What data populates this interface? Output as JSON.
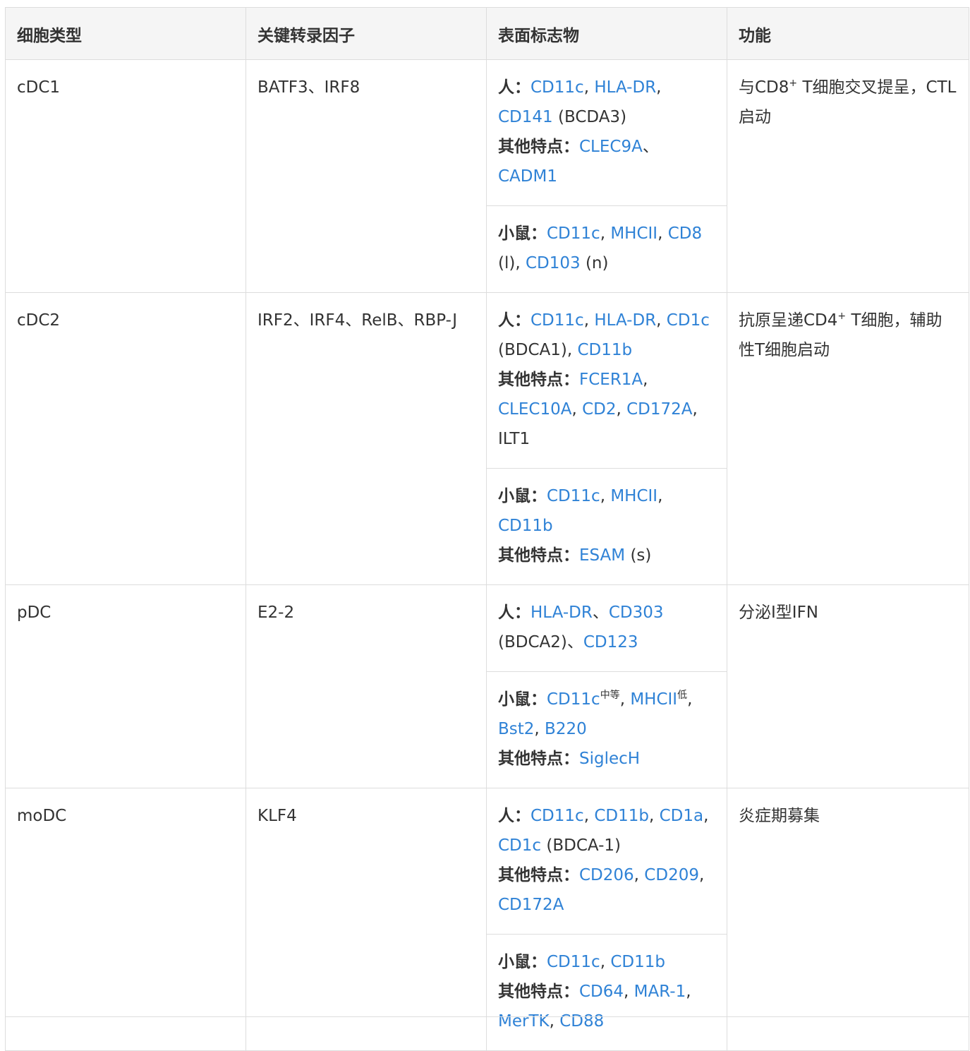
{
  "headers": [
    "细胞类型",
    "关键转录因子",
    "表面标志物",
    "功能"
  ],
  "rows": [
    {
      "cell_type": "cDC1",
      "tfs": "BATF3、IRF8",
      "function": {
        "before": "与CD8",
        "sup": "+",
        "after": " T细胞交叉提呈，CTL启动"
      },
      "marker_blocks": [
        {
          "lines": [
            [
              {
                "k": "lbl",
                "t": "人："
              },
              {
                "k": "lk",
                "t": "CD11c"
              },
              {
                "k": "pl",
                "t": ", "
              },
              {
                "k": "lk",
                "t": "HLA-DR"
              },
              {
                "k": "pl",
                "t": ", "
              },
              {
                "k": "lk",
                "t": "CD141"
              },
              {
                "k": "pl",
                "t": " (BCDA3)"
              }
            ],
            [
              {
                "k": "lbl",
                "t": "其他特点："
              },
              {
                "k": "lk",
                "t": "CLEC9A"
              },
              {
                "k": "pl",
                "t": "、"
              },
              {
                "k": "lk",
                "t": "CADM1"
              }
            ]
          ]
        },
        {
          "lines": [
            [
              {
                "k": "lbl",
                "t": "小鼠："
              },
              {
                "k": "lk",
                "t": "CD11c"
              },
              {
                "k": "pl",
                "t": ", "
              },
              {
                "k": "lk",
                "t": "MHCII"
              },
              {
                "k": "pl",
                "t": ", "
              },
              {
                "k": "lk",
                "t": "CD8"
              },
              {
                "k": "pl",
                "t": " (l), "
              },
              {
                "k": "lk",
                "t": "CD103"
              },
              {
                "k": "pl",
                "t": " (n)"
              }
            ]
          ]
        }
      ]
    },
    {
      "cell_type": "cDC2",
      "tfs": "IRF2、IRF4、RelB、RBP-J",
      "function": {
        "before": "抗原呈递CD4",
        "sup": "+",
        "after": " T细胞，辅助性T细胞启动"
      },
      "marker_blocks": [
        {
          "lines": [
            [
              {
                "k": "lbl",
                "t": "人："
              },
              {
                "k": "lk",
                "t": "CD11c"
              },
              {
                "k": "pl",
                "t": ", "
              },
              {
                "k": "lk",
                "t": "HLA-DR"
              },
              {
                "k": "pl",
                "t": ", "
              },
              {
                "k": "lk",
                "t": "CD1c"
              },
              {
                "k": "pl",
                "t": " (BDCA1), "
              },
              {
                "k": "lk",
                "t": "CD11b"
              }
            ],
            [
              {
                "k": "lbl",
                "t": "其他特点："
              },
              {
                "k": "lk",
                "t": "FCER1A"
              },
              {
                "k": "pl",
                "t": ", "
              },
              {
                "k": "lk",
                "t": "CLEC10A"
              },
              {
                "k": "pl",
                "t": ", "
              },
              {
                "k": "lk",
                "t": "CD2"
              },
              {
                "k": "pl",
                "t": ", "
              },
              {
                "k": "lk",
                "t": "CD172A"
              },
              {
                "k": "pl",
                "t": ", ILT1"
              }
            ]
          ]
        },
        {
          "lines": [
            [
              {
                "k": "lbl",
                "t": "小鼠："
              },
              {
                "k": "lk",
                "t": "CD11c"
              },
              {
                "k": "pl",
                "t": ", "
              },
              {
                "k": "lk",
                "t": "MHCII"
              },
              {
                "k": "pl",
                "t": ", "
              },
              {
                "k": "lk",
                "t": "CD11b"
              }
            ],
            [
              {
                "k": "lbl",
                "t": "其他特点："
              },
              {
                "k": "lk",
                "t": "ESAM"
              },
              {
                "k": "pl",
                "t": " (s)"
              }
            ]
          ]
        }
      ]
    },
    {
      "cell_type": "pDC",
      "tfs": "E2-2",
      "function": {
        "before": "分泌I型IFN",
        "sup": "",
        "after": ""
      },
      "marker_blocks": [
        {
          "lines": [
            [
              {
                "k": "lbl",
                "t": "人："
              },
              {
                "k": "lk",
                "t": "HLA-DR"
              },
              {
                "k": "pl",
                "t": "、"
              },
              {
                "k": "lk",
                "t": "CD303"
              },
              {
                "k": "pl",
                "t": " (BDCA2)、"
              },
              {
                "k": "lk",
                "t": "CD123"
              }
            ]
          ]
        },
        {
          "lines": [
            [
              {
                "k": "lbl",
                "t": "小鼠："
              },
              {
                "k": "lk",
                "t": "CD11c"
              },
              {
                "k": "sp",
                "t": "中等"
              },
              {
                "k": "pl",
                "t": ", "
              },
              {
                "k": "lk",
                "t": "MHCII"
              },
              {
                "k": "sp",
                "t": "低"
              },
              {
                "k": "pl",
                "t": ", "
              },
              {
                "k": "lk",
                "t": "Bst2"
              },
              {
                "k": "pl",
                "t": ", "
              },
              {
                "k": "lk",
                "t": "B220"
              }
            ],
            [
              {
                "k": "lbl",
                "t": "其他特点："
              },
              {
                "k": "lk",
                "t": "SiglecH"
              }
            ]
          ]
        }
      ]
    },
    {
      "cell_type": "moDC",
      "tfs": "KLF4",
      "function": {
        "before": "炎症期募集",
        "sup": "",
        "after": ""
      },
      "marker_blocks": [
        {
          "lines": [
            [
              {
                "k": "lbl",
                "t": "人："
              },
              {
                "k": "lk",
                "t": "CD11c"
              },
              {
                "k": "pl",
                "t": ", "
              },
              {
                "k": "lk",
                "t": "CD11b"
              },
              {
                "k": "pl",
                "t": ", "
              },
              {
                "k": "lk",
                "t": "CD1a"
              },
              {
                "k": "pl",
                "t": ", "
              },
              {
                "k": "lk",
                "t": "CD1c"
              },
              {
                "k": "pl",
                "t": " (BDCA-1)"
              }
            ],
            [
              {
                "k": "lbl",
                "t": "其他特点："
              },
              {
                "k": "lk",
                "t": "CD206"
              },
              {
                "k": "pl",
                "t": ", "
              },
              {
                "k": "lk",
                "t": "CD209"
              },
              {
                "k": "pl",
                "t": ", "
              },
              {
                "k": "lk",
                "t": "CD172A"
              }
            ]
          ]
        },
        {
          "lines": [
            [
              {
                "k": "lbl",
                "t": "小鼠："
              },
              {
                "k": "lk",
                "t": "CD11c"
              },
              {
                "k": "pl",
                "t": ", "
              },
              {
                "k": "lk",
                "t": "CD11b"
              }
            ],
            [
              {
                "k": "lbl",
                "t": "其他特点："
              },
              {
                "k": "lk",
                "t": "CD64"
              },
              {
                "k": "pl",
                "t": ", "
              },
              {
                "k": "lk",
                "t": "MAR-1"
              },
              {
                "k": "pl",
                "t": ", "
              },
              {
                "k": "lk",
                "t": "MerTK"
              },
              {
                "k": "pl",
                "t": ", "
              },
              {
                "k": "lk",
                "t": "CD88"
              }
            ]
          ]
        }
      ]
    }
  ]
}
